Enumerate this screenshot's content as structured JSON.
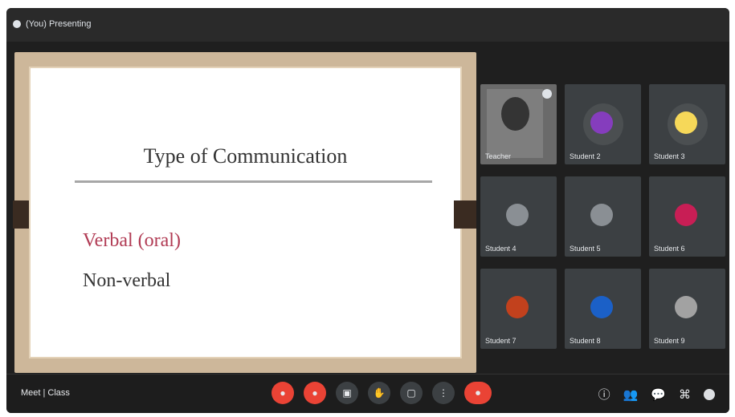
{
  "topbar": {
    "presenter_text": "(You) Presenting"
  },
  "slide": {
    "title": "Type of Communication",
    "bullets": [
      "Verbal (oral)",
      "Non-verbal"
    ]
  },
  "participants": [
    {
      "name": "Teacher",
      "avatar": "photo"
    },
    {
      "name": "Student 2",
      "avatar": "purple"
    },
    {
      "name": "Student 3",
      "avatar": "yellow"
    },
    {
      "name": "Student 4",
      "avatar": "gray"
    },
    {
      "name": "Student 5",
      "avatar": "gray"
    },
    {
      "name": "Student 6",
      "avatar": "pink"
    },
    {
      "name": "Student 7",
      "avatar": "orange"
    },
    {
      "name": "Student 8",
      "avatar": "blue"
    },
    {
      "name": "Student 9",
      "avatar": "light"
    }
  ],
  "bottom": {
    "meeting_text": "Meet | Class",
    "icons": [
      "mic-off",
      "camera-off",
      "captions",
      "raise-hand",
      "present",
      "more",
      "end-call"
    ],
    "right_icons": [
      "info",
      "people",
      "chat",
      "activities",
      "settings"
    ]
  },
  "colors": {
    "accent_red": "#ea4335",
    "slide_frame": "#cdb79a",
    "tile_bg": "#3c4043"
  }
}
